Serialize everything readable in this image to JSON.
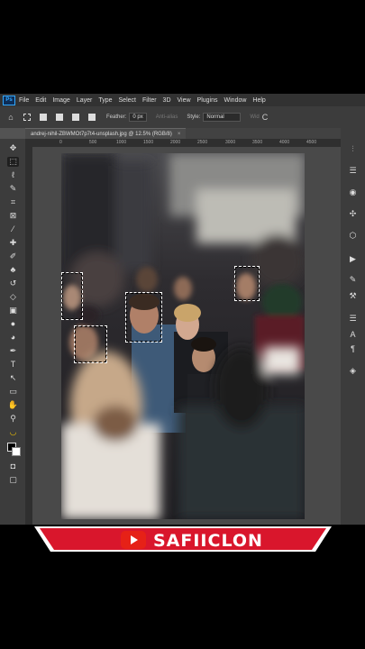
{
  "menu": {
    "logo": "Ps",
    "items": [
      "File",
      "Edit",
      "Image",
      "Layer",
      "Type",
      "Select",
      "Filter",
      "3D",
      "View",
      "Plugins",
      "Window",
      "Help"
    ]
  },
  "options": {
    "feather_label": "Feather:",
    "feather_value": "0 px",
    "anti_alias": "Anti-alias",
    "style_label": "Style:",
    "style_value": "Normal",
    "width_label": "Wid",
    "width_glyph": "C",
    "home_icon": "home-icon"
  },
  "document": {
    "tab_title": "andrej-nihil-ZBWMOt7p7t4-unsplash.jpg @ 12.5% (RGB/8)",
    "close": "×"
  },
  "ruler": {
    "ticks": [
      "0",
      "500",
      "1000",
      "1500",
      "2000",
      "2500",
      "3000",
      "3500",
      "4000",
      "4500"
    ]
  },
  "banner": {
    "channel": "SAFIICLON",
    "accent": "#d9162c"
  }
}
